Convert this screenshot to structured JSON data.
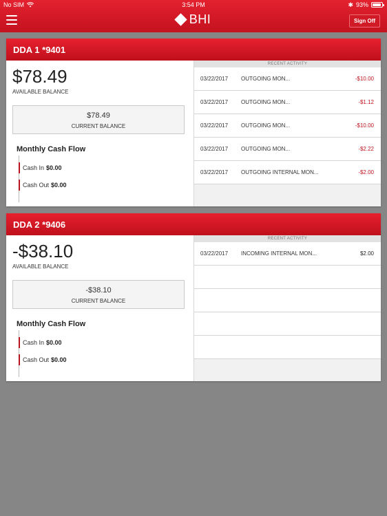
{
  "status_bar": {
    "carrier": "No SIM",
    "time": "3:54 PM",
    "battery_text": "93%",
    "battery_level": 0.93
  },
  "header": {
    "logo_text": "BHI",
    "sign_off_label": "Sign Off"
  },
  "recent_activity_label": "RECENT ACTIVITY",
  "accounts": [
    {
      "title": "DDA 1 *9401",
      "available_balance": "$78.49",
      "available_label": "AVAILABLE BALANCE",
      "current_balance": "$78.49",
      "current_label": "CURRENT BALANCE",
      "cash_flow_title": "Monthly Cash Flow",
      "cash_in_label": "Cash In",
      "cash_in_value": "$0.00",
      "cash_out_label": "Cash Out",
      "cash_out_value": "$0.00",
      "activity": [
        {
          "date": "03/22/2017",
          "desc": "OUTGOING MON...",
          "amount": "-$10.00"
        },
        {
          "date": "03/22/2017",
          "desc": "OUTGOING MON...",
          "amount": "-$1.12"
        },
        {
          "date": "03/22/2017",
          "desc": "OUTGOING MON...",
          "amount": "-$10.00"
        },
        {
          "date": "03/22/2017",
          "desc": "OUTGOING MON...",
          "amount": "-$2.22"
        },
        {
          "date": "03/22/2017",
          "desc": "OUTGOING INTERNAL MON...",
          "amount": "-$2.00"
        }
      ]
    },
    {
      "title": "DDA 2 *9406",
      "available_balance": "-$38.10",
      "available_label": "AVAILABLE BALANCE",
      "current_balance": "-$38.10",
      "current_label": "CURRENT BALANCE",
      "cash_flow_title": "Monthly Cash Flow",
      "cash_in_label": "Cash In",
      "cash_in_value": "$0.00",
      "cash_out_label": "Cash Out",
      "cash_out_value": "$0.00",
      "activity": [
        {
          "date": "03/22/2017",
          "desc": "INCOMING INTERNAL MON...",
          "amount": "$2.00"
        }
      ]
    }
  ],
  "colors": {
    "brand_red": "#d01a26",
    "negative": "#c0141f",
    "background": "#868686"
  }
}
